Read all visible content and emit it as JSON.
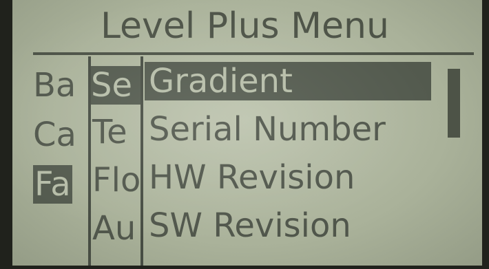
{
  "screen": {
    "title": "Level Plus Menu"
  },
  "menus": {
    "base": [
      "Ba",
      "Ca",
      "Fa",
      ""
    ],
    "base_selected_index": 2,
    "second": [
      "Se",
      "Te",
      "Flo",
      "Au"
    ],
    "second_selected_index": 0,
    "submenu": [
      "Gradient",
      "Serial Number",
      "HW Revision",
      "SW Revision"
    ],
    "submenu_selected_index": 0
  },
  "colors": {
    "lcd_background": "#b1b8a1",
    "lcd_text": "#4d5347",
    "highlight": "#535a4e"
  }
}
